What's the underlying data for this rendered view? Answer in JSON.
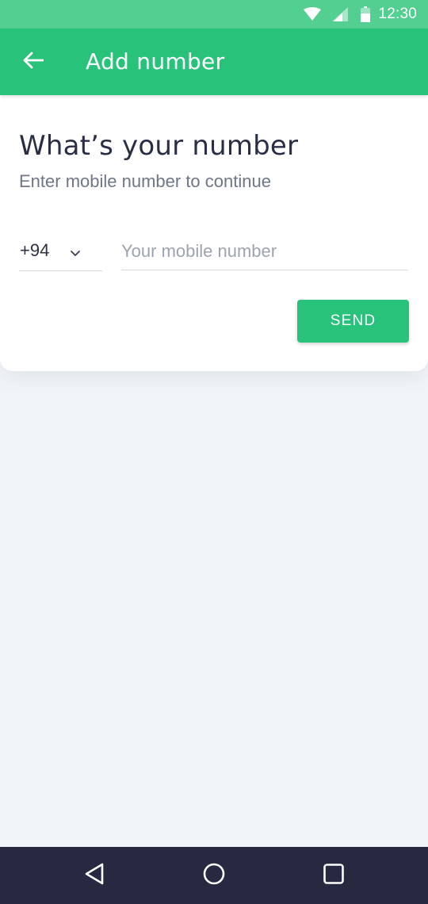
{
  "status_bar": {
    "time": "12:30",
    "icons": [
      "wifi-icon",
      "signal-icon",
      "battery-icon"
    ]
  },
  "app_bar": {
    "back_icon": "arrow-left-icon",
    "title": "Add number"
  },
  "form": {
    "heading": "What’s your number",
    "subheading": "Enter mobile number to continue",
    "country_code": "+94",
    "phone_value": "",
    "phone_placeholder": "Your mobile number",
    "send_label": "SEND"
  },
  "nav_bar": {
    "buttons": [
      "back-triangle-icon",
      "home-circle-icon",
      "recents-square-icon"
    ]
  },
  "colors": {
    "status_bar": "#52CF91",
    "primary": "#28C27A",
    "background": "#F2F5F8",
    "nav_bar": "#262940",
    "heading_text": "#2A2E45",
    "secondary_text": "#6F7688"
  }
}
